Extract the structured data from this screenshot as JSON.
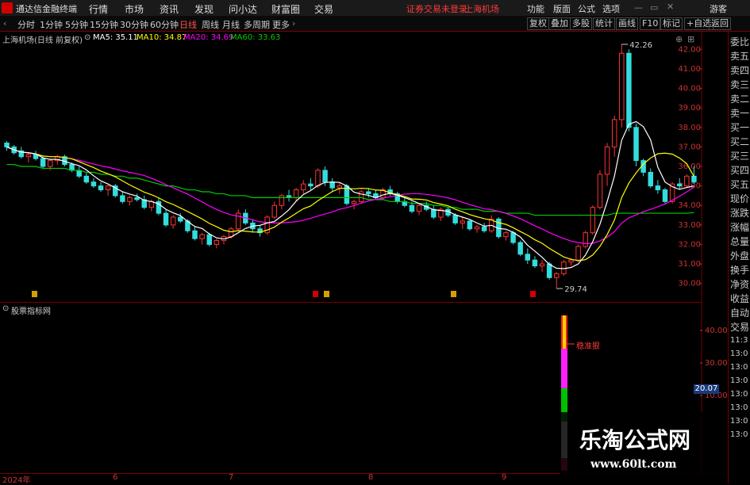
{
  "menubar": {
    "app_name": "通达信金融终端",
    "items": [
      "行情",
      "市场",
      "资讯",
      "发现",
      "问小达",
      "财富圈",
      "交易"
    ],
    "notice": "证券交易未登录",
    "market": "上海机场",
    "right_items": [
      "功能",
      "版面",
      "公式",
      "选项"
    ],
    "guest": "游客"
  },
  "toolbar": {
    "periods": [
      "分时",
      "1分钟",
      "5分钟",
      "15分钟",
      "30分钟",
      "60分钟",
      "日线",
      "周线",
      "月线",
      "多周期",
      "更多"
    ],
    "active_period": "日线",
    "right_buttons": [
      "复权",
      "叠加",
      "多股",
      "统计",
      "画线",
      "F10",
      "标记",
      "+自选",
      "返回"
    ]
  },
  "chart_header": {
    "name": "上海机场(日线 前复权)",
    "ma5": "MA5: 35.11",
    "ma10": "MA10: 34.87",
    "ma20": "MA20: 34.69",
    "ma60": "MA60: 33.63"
  },
  "colors": {
    "ma5": "#ffffff",
    "ma10": "#ffff00",
    "ma20": "#ff00ff",
    "ma60": "#00cc00",
    "up": "#ff3333",
    "down": "#33dddd",
    "axis": "#cc3333"
  },
  "price_axis": [
    "42.00",
    "41.00",
    "40.00",
    "39.00",
    "38.00",
    "37.00",
    "36.00",
    "35.00",
    "34.00",
    "33.00",
    "32.00",
    "31.00",
    "30.00"
  ],
  "annotations": {
    "high": "42.26",
    "low": "29.74"
  },
  "sub_chart": {
    "name": "股票指标网",
    "label": "稳准狠",
    "axis": [
      "40.00",
      "30.00",
      "20.00",
      "10.00"
    ],
    "current": "20.07"
  },
  "x_axis": [
    "2024年",
    "6",
    "7",
    "8",
    "9"
  ],
  "side_panel": {
    "items": [
      "委比",
      "卖五",
      "卖四",
      "卖三",
      "卖二",
      "卖一",
      "买一",
      "买二",
      "买三",
      "买四",
      "买五",
      "现价",
      "涨跌",
      "涨幅",
      "总量",
      "外盘",
      "换手",
      "净资",
      "收益"
    ],
    "lower_items": [
      "自动",
      "交易"
    ],
    "times": [
      "11:3",
      "13:0",
      "13:0",
      "13:0",
      "13:0",
      "13:0",
      "13:0",
      "13:0"
    ]
  },
  "watermark": {
    "line1": "乐淘公式网",
    "line2": "www.60lt.com"
  },
  "chart_data": {
    "type": "candlestick",
    "title": "上海机场(日线 前复权)",
    "ylim": [
      29.5,
      42.5
    ],
    "ohlc": [
      [
        37.2,
        37.3,
        36.8,
        37.0
      ],
      [
        37.0,
        37.1,
        36.6,
        36.7
      ],
      [
        36.8,
        37.0,
        36.4,
        36.5
      ],
      [
        36.5,
        36.7,
        36.2,
        36.6
      ],
      [
        36.6,
        36.8,
        36.3,
        36.4
      ],
      [
        36.4,
        36.5,
        35.9,
        36.0
      ],
      [
        36.0,
        36.4,
        35.8,
        36.3
      ],
      [
        36.3,
        36.6,
        36.1,
        36.5
      ],
      [
        36.5,
        36.6,
        36.0,
        36.1
      ],
      [
        36.1,
        36.2,
        35.7,
        35.8
      ],
      [
        35.8,
        36.0,
        35.4,
        35.5
      ],
      [
        35.5,
        35.7,
        35.1,
        35.2
      ],
      [
        35.2,
        35.4,
        34.9,
        35.0
      ],
      [
        35.0,
        35.2,
        34.7,
        34.8
      ],
      [
        34.8,
        35.1,
        34.5,
        35.0
      ],
      [
        35.0,
        35.1,
        34.4,
        34.5
      ],
      [
        34.5,
        34.7,
        34.1,
        34.2
      ],
      [
        34.2,
        34.5,
        34.0,
        34.4
      ],
      [
        34.4,
        34.6,
        34.2,
        34.3
      ],
      [
        34.3,
        34.5,
        33.8,
        33.9
      ],
      [
        33.9,
        34.3,
        33.7,
        34.2
      ],
      [
        34.2,
        34.4,
        33.5,
        33.6
      ],
      [
        33.6,
        33.8,
        32.9,
        33.0
      ],
      [
        33.0,
        33.5,
        32.8,
        33.4
      ],
      [
        33.4,
        33.6,
        33.1,
        33.2
      ],
      [
        33.2,
        33.3,
        32.6,
        32.7
      ],
      [
        32.7,
        32.9,
        32.2,
        32.3
      ],
      [
        32.3,
        32.6,
        32.0,
        32.5
      ],
      [
        32.5,
        32.6,
        31.9,
        32.0
      ],
      [
        32.0,
        32.3,
        31.8,
        32.2
      ],
      [
        32.2,
        32.5,
        32.0,
        32.4
      ],
      [
        32.4,
        32.9,
        32.3,
        32.8
      ],
      [
        32.8,
        33.8,
        32.7,
        33.6
      ],
      [
        33.6,
        33.8,
        33.0,
        33.1
      ],
      [
        33.1,
        33.3,
        32.6,
        32.8
      ],
      [
        32.8,
        33.0,
        32.4,
        32.6
      ],
      [
        32.6,
        33.5,
        32.5,
        33.4
      ],
      [
        33.4,
        34.2,
        33.3,
        34.0
      ],
      [
        34.0,
        34.6,
        33.8,
        34.5
      ],
      [
        34.5,
        34.8,
        34.2,
        34.4
      ],
      [
        34.4,
        34.9,
        34.2,
        34.8
      ],
      [
        34.8,
        35.3,
        34.6,
        35.1
      ],
      [
        35.1,
        35.4,
        34.8,
        35.0
      ],
      [
        35.0,
        35.9,
        34.9,
        35.8
      ],
      [
        35.8,
        36.0,
        35.0,
        35.2
      ],
      [
        35.2,
        35.4,
        34.7,
        34.9
      ],
      [
        34.9,
        35.2,
        34.6,
        35.0
      ],
      [
        35.0,
        35.1,
        34.0,
        34.1
      ],
      [
        34.1,
        34.3,
        33.8,
        34.2
      ],
      [
        34.2,
        34.8,
        34.1,
        34.7
      ],
      [
        34.7,
        34.9,
        34.4,
        34.6
      ],
      [
        34.6,
        34.8,
        34.3,
        34.4
      ],
      [
        34.4,
        34.9,
        34.3,
        34.8
      ],
      [
        34.8,
        35.0,
        34.5,
        34.6
      ],
      [
        34.6,
        34.7,
        34.1,
        34.2
      ],
      [
        34.2,
        34.4,
        33.9,
        34.0
      ],
      [
        34.0,
        34.2,
        33.6,
        33.7
      ],
      [
        33.7,
        34.1,
        33.5,
        34.0
      ],
      [
        34.0,
        34.2,
        33.7,
        33.8
      ],
      [
        33.8,
        34.0,
        33.3,
        33.4
      ],
      [
        33.4,
        33.9,
        33.2,
        33.8
      ],
      [
        33.8,
        33.9,
        33.4,
        33.5
      ],
      [
        33.5,
        33.6,
        33.0,
        33.1
      ],
      [
        33.1,
        33.4,
        32.8,
        33.2
      ],
      [
        33.2,
        33.3,
        32.7,
        32.8
      ],
      [
        32.8,
        33.0,
        32.6,
        32.9
      ],
      [
        32.9,
        33.1,
        32.6,
        32.7
      ],
      [
        32.7,
        33.5,
        32.6,
        33.3
      ],
      [
        33.3,
        33.4,
        32.3,
        32.4
      ],
      [
        32.4,
        32.7,
        32.2,
        32.6
      ],
      [
        32.6,
        32.7,
        32.0,
        32.1
      ],
      [
        32.1,
        32.2,
        31.4,
        31.5
      ],
      [
        31.5,
        31.8,
        31.0,
        31.2
      ],
      [
        31.2,
        31.4,
        30.8,
        30.9
      ],
      [
        30.9,
        31.2,
        30.6,
        31.0
      ],
      [
        31.0,
        31.1,
        30.2,
        30.3
      ],
      [
        30.3,
        30.6,
        29.74,
        30.5
      ],
      [
        30.5,
        31.2,
        30.4,
        31.1
      ],
      [
        31.1,
        31.3,
        30.9,
        31.2
      ],
      [
        31.2,
        32.0,
        31.1,
        31.9
      ],
      [
        31.9,
        32.7,
        31.8,
        32.6
      ],
      [
        32.6,
        34.0,
        32.5,
        33.9
      ],
      [
        33.9,
        35.8,
        33.8,
        35.6
      ],
      [
        35.6,
        37.2,
        35.0,
        37.0
      ],
      [
        37.0,
        38.6,
        36.5,
        38.4
      ],
      [
        38.4,
        42.26,
        38.0,
        41.8
      ],
      [
        41.8,
        42.0,
        37.8,
        38.0
      ],
      [
        38.0,
        38.2,
        36.0,
        36.3
      ],
      [
        36.3,
        36.4,
        35.5,
        35.7
      ],
      [
        35.7,
        35.9,
        34.9,
        35.0
      ],
      [
        35.0,
        35.3,
        34.6,
        34.8
      ],
      [
        34.8,
        34.9,
        34.1,
        34.2
      ],
      [
        34.2,
        35.2,
        34.1,
        35.1
      ],
      [
        35.1,
        35.4,
        34.8,
        35.0
      ],
      [
        35.0,
        35.6,
        34.9,
        35.5
      ],
      [
        35.5,
        36.0,
        35.1,
        35.2
      ]
    ],
    "ma60": [
      36.1,
      36.1,
      36.0,
      36.0,
      36.0,
      35.9,
      35.9,
      35.9,
      35.9,
      35.8,
      35.8,
      35.7,
      35.7,
      35.6,
      35.6,
      35.5,
      35.5,
      35.4,
      35.4,
      35.3,
      35.2,
      35.1,
      35.0,
      35.0,
      34.9,
      34.8,
      34.8,
      34.7,
      34.7,
      34.6,
      34.6,
      34.5,
      34.5,
      34.5,
      34.4,
      34.4,
      34.4,
      34.4,
      34.4,
      34.4,
      34.4,
      34.4,
      34.4,
      34.4,
      34.4,
      34.4,
      34.4,
      34.4,
      34.4,
      34.4,
      34.3,
      34.3,
      34.3,
      34.2,
      34.2,
      34.2,
      34.1,
      34.1,
      34.1,
      34.0,
      34.0,
      33.9,
      33.9,
      33.8,
      33.8,
      33.8,
      33.7,
      33.7,
      33.7,
      33.6,
      33.6,
      33.6,
      33.6,
      33.5,
      33.5,
      33.5,
      33.5,
      33.5,
      33.5,
      33.5,
      33.5,
      33.5,
      33.5,
      33.5,
      33.6,
      33.6,
      33.6,
      33.6,
      33.6,
      33.6,
      33.6,
      33.6,
      33.6,
      33.6,
      33.6,
      33.63
    ]
  }
}
